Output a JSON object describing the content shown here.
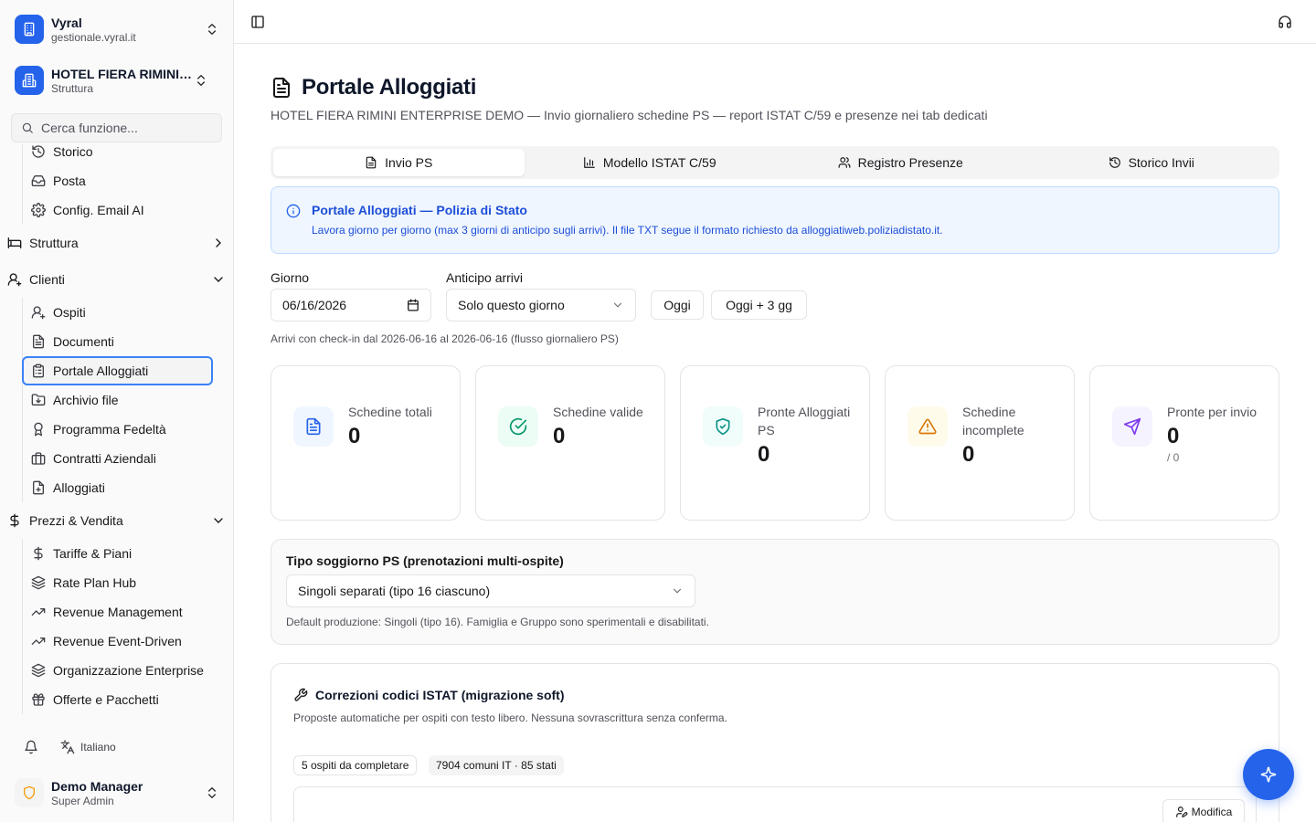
{
  "sidebar": {
    "org": {
      "title": "Vyral",
      "subtitle": "gestionale.vyral.it"
    },
    "property": {
      "title": "HOTEL FIERA RIMINI ENTERPRISE DEMO",
      "subtitle": "Struttura"
    },
    "search_placeholder": "Cerca funzione...",
    "items_top": [
      {
        "label": "Storico",
        "icon": "history-icon"
      },
      {
        "label": "Posta",
        "icon": "mail-icon"
      },
      {
        "label": "Config. Email AI",
        "icon": "gear-icon"
      }
    ],
    "groups": {
      "struttura": "Struttura",
      "clienti": "Clienti",
      "prezzi": "Prezzi & Vendita"
    },
    "clienti_items": [
      {
        "label": "Ospiti",
        "icon": "user-icon"
      },
      {
        "label": "Documenti",
        "icon": "document-icon"
      },
      {
        "label": "Portale Alloggiati",
        "icon": "clipboard-icon"
      },
      {
        "label": "Archivio file",
        "icon": "folder-icon"
      },
      {
        "label": "Programma Fedeltà",
        "icon": "award-icon"
      },
      {
        "label": "Contratti Aziendali",
        "icon": "briefcase-icon"
      },
      {
        "label": "Alloggiati",
        "icon": "file-shield-icon"
      }
    ],
    "prezzi_items": [
      {
        "label": "Tariffe & Piani",
        "icon": "dollar-icon"
      },
      {
        "label": "Rate Plan Hub",
        "icon": "layers-icon"
      },
      {
        "label": "Revenue Management",
        "icon": "trend-icon"
      },
      {
        "label": "Revenue Event-Driven",
        "icon": "trend-icon"
      },
      {
        "label": "Organizzazione Enterprise",
        "icon": "layers-icon"
      },
      {
        "label": "Offerte e Pacchetti",
        "icon": "gift-icon"
      }
    ],
    "language": "Italiano",
    "user": {
      "name": "Demo Manager",
      "role": "Super Admin"
    }
  },
  "page": {
    "title": "Portale Alloggiati",
    "subtitle": "HOTEL FIERA RIMINI ENTERPRISE DEMO — Invio giornaliero schedine PS — report ISTAT C/59 e presenze nei tab dedicati"
  },
  "tabs": [
    "Invio PS",
    "Modello ISTAT C/59",
    "Registro Presenze",
    "Storico Invii"
  ],
  "alert": {
    "title": "Portale Alloggiati — Polizia di Stato",
    "text": "Lavora giorno per giorno (max 3 giorni di anticipo sugli arrivi). Il file TXT segue il formato richiesto da alloggiatiweb.poliziadistato.it."
  },
  "filters": {
    "day_label": "Giorno",
    "day_value": "06/16/2026",
    "advance_label": "Anticipo arrivi",
    "advance_value": "Solo questo giorno",
    "today_btn": "Oggi",
    "today3_btn": "Oggi + 3 gg",
    "range_hint": "Arrivi con check-in dal 2026-06-16 al 2026-06-16 (flusso giornaliero PS)"
  },
  "stats": [
    {
      "label": "Schedine totali",
      "value": "0",
      "color": "#2563eb",
      "bg": "#eff6ff"
    },
    {
      "label": "Schedine valide",
      "value": "0",
      "color": "#059669",
      "bg": "#ecfdf5"
    },
    {
      "label": "Pronte Alloggiati PS",
      "value": "0",
      "color": "#0d9488",
      "bg": "#f0fdfa"
    },
    {
      "label": "Schedine incomplete",
      "value": "0",
      "color": "#d97706",
      "bg": "#fffbeb"
    },
    {
      "label": "Pronte per invio",
      "value": "0",
      "sub": "/ 0",
      "color": "#7c3aed",
      "bg": "#f5f3ff"
    }
  ],
  "stay_type": {
    "label": "Tipo soggiorno PS (prenotazioni multi-ospite)",
    "value": "Singoli separati (tipo 16 ciascuno)",
    "hint": "Default produzione: Singoli (tipo 16). Famiglia e Gruppo sono sperimentali e disabilitati."
  },
  "istat": {
    "title": "Correzioni codici ISTAT (migrazione soft)",
    "desc": "Proposte automatiche per ospiti con testo libero. Nessuna sovrascrittura senza conferma.",
    "badge1": "5 ospiti da completare",
    "badge2": "7904 comuni IT · 85 stati",
    "edit_btn": "Modifica"
  }
}
